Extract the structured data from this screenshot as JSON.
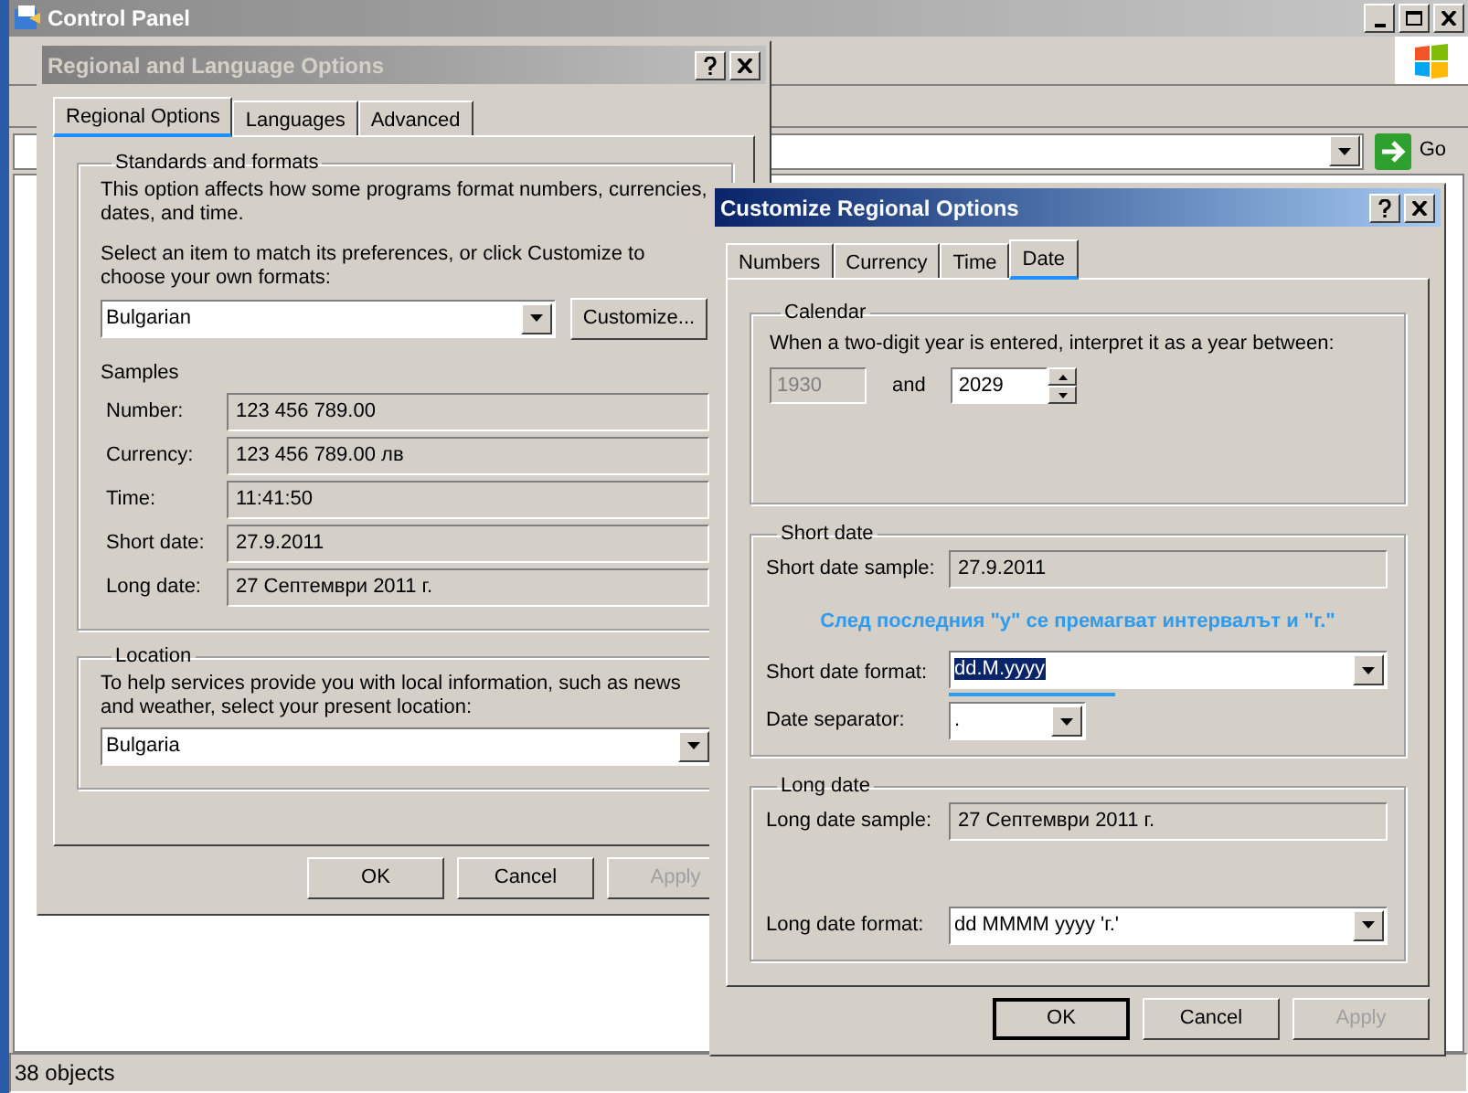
{
  "control_panel": {
    "title": "Control Panel",
    "go_label": "Go",
    "status": "38 objects"
  },
  "regional_dialog": {
    "title": "Regional and Language Options",
    "active": false,
    "tabs": [
      {
        "label": "Regional Options",
        "selected": true
      },
      {
        "label": "Languages",
        "selected": false
      },
      {
        "label": "Advanced",
        "selected": false
      }
    ],
    "standards": {
      "legend": "Standards and formats",
      "description": "This option affects how some programs format numbers, currencies, dates, and time.",
      "prompt": "Select an item to match its preferences, or click Customize to choose your own formats:",
      "format": "Bulgarian",
      "customize_button": "Customize...",
      "samples_label": "Samples",
      "samples": [
        {
          "label": "Number:",
          "value": "123 456 789.00"
        },
        {
          "label": "Currency:",
          "value": "123 456 789.00 лв"
        },
        {
          "label": "Time:",
          "value": "11:41:50"
        },
        {
          "label": "Short date:",
          "value": "27.9.2011"
        },
        {
          "label": "Long date:",
          "value": "27 Септември 2011 г."
        }
      ]
    },
    "location": {
      "legend": "Location",
      "description": "To help services provide you with local information, such as news and weather, select your present location:",
      "value": "Bulgaria"
    },
    "buttons": [
      {
        "label": "OK",
        "disabled": false,
        "focused": false
      },
      {
        "label": "Cancel",
        "disabled": false,
        "focused": false
      },
      {
        "label": "Apply",
        "disabled": true,
        "focused": false
      }
    ]
  },
  "customize_dialog": {
    "title": "Customize Regional Options",
    "active": true,
    "tabs": [
      {
        "label": "Numbers",
        "selected": false
      },
      {
        "label": "Currency",
        "selected": false
      },
      {
        "label": "Time",
        "selected": false
      },
      {
        "label": "Date",
        "selected": true
      }
    ],
    "calendar": {
      "legend": "Calendar",
      "description": "When a two-digit year is entered, interpret it as a year between:",
      "from_year": {
        "value": "1930",
        "disabled": true
      },
      "and_label": "and",
      "to_year": {
        "value": "2029",
        "disabled": false
      }
    },
    "short_date": {
      "legend": "Short date",
      "sample_label": "Short date sample:",
      "sample": "27.9.2011",
      "note": "След последния \"у\" се премагват интервалът и \"г.\"",
      "format_label": "Short date format:",
      "format": "dd.M.yyyy",
      "format_highlighted": true,
      "separator_label": "Date separator:",
      "separator": "."
    },
    "long_date": {
      "legend": "Long date",
      "sample_label": "Long date sample:",
      "sample": "27 Септември 2011 г.",
      "format_label": "Long date format:",
      "format": "dd MMMM yyyy 'г.'"
    },
    "buttons": [
      {
        "label": "OK",
        "disabled": false,
        "focused": true
      },
      {
        "label": "Cancel",
        "disabled": false,
        "focused": false
      },
      {
        "label": "Apply",
        "disabled": true,
        "focused": false
      }
    ]
  }
}
